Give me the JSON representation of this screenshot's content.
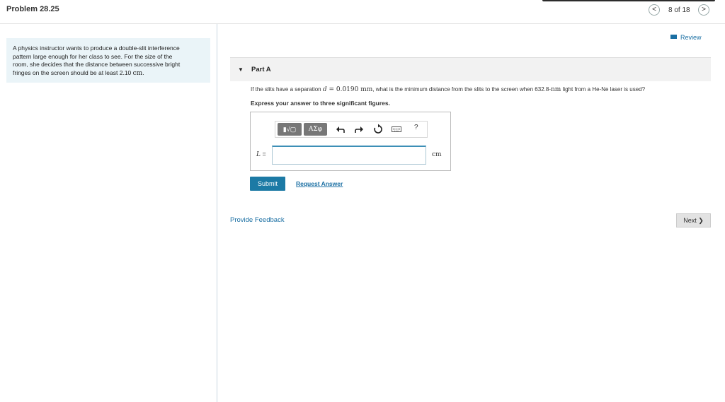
{
  "header": {
    "title": "Problem 28.25",
    "prev_glyph": "<",
    "next_glyph": ">",
    "position": "8 of 18"
  },
  "problem": {
    "statement_line1": "A physics instructor wants to produce a double-slit interference",
    "statement_line2": "pattern large enough for her class to see. For the size of the",
    "statement_line3": "room, she decides that the distance between successive bright",
    "statement_line4_prefix": "fringes on the screen should be at least 2.10 ",
    "statement_line4_unit": "cm",
    "statement_line4_suffix": "."
  },
  "review": {
    "label": "Review",
    "icon": "review-icon"
  },
  "part": {
    "label": "Part A",
    "question_prefix": "If the slits have a separation ",
    "question_var": "d",
    "question_eq": " = 0.0190 ",
    "question_unit1": "mm",
    "question_mid": ", what is the minimum distance from the slits to the screen when 632.8-",
    "question_unit2": "nm",
    "question_suffix": " light from a He-Ne laser is used?",
    "instruction": "Express your answer to three significant figures."
  },
  "toolbar": {
    "template_btn": "▮√▢",
    "greek_btn": "ΑΣφ",
    "undo_icon": "undo-icon",
    "redo_icon": "redo-icon",
    "reset_icon": "reset-icon",
    "keyboard_icon": "keyboard-icon",
    "help_label": "?"
  },
  "answer": {
    "variable": "L",
    "equals": "=",
    "value": "",
    "unit": "cm"
  },
  "actions": {
    "submit": "Submit",
    "request_answer": "Request Answer",
    "feedback": "Provide Feedback",
    "next": "Next",
    "next_glyph": "❯"
  },
  "colors": {
    "link": "#1a6fa3",
    "submit_bg": "#1c7aa5",
    "problem_bg": "#eaf4f8",
    "part_bg": "#f2f2f2"
  }
}
